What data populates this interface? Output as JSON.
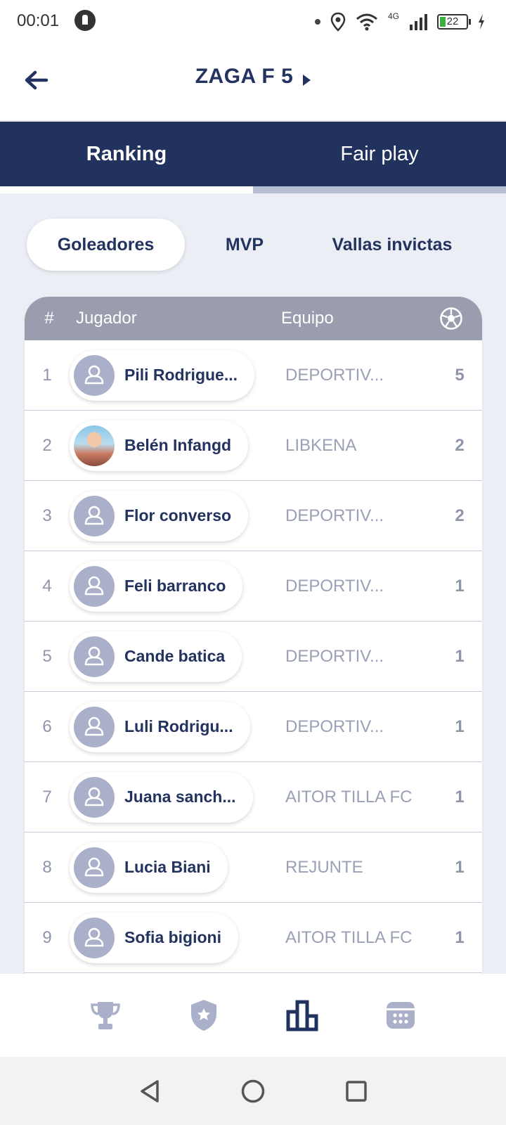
{
  "status_bar": {
    "time": "00:01",
    "network": "4G",
    "battery": "22"
  },
  "header": {
    "title": "ZAGA F 5"
  },
  "top_tabs": [
    {
      "label": "Ranking",
      "active": true
    },
    {
      "label": "Fair play",
      "active": false
    }
  ],
  "sub_tabs": [
    {
      "label": "Goleadores",
      "active": true
    },
    {
      "label": "MVP",
      "active": false
    },
    {
      "label": "Vallas invictas",
      "active": false
    }
  ],
  "table": {
    "columns": {
      "rank": "#",
      "player": "Jugador",
      "team": "Equipo",
      "goals_icon": "soccer-ball-icon"
    },
    "rows": [
      {
        "rank": "1",
        "player": "Pili Rodrigue...",
        "team": "DEPORTIV...",
        "goals": "5",
        "avatar": "placeholder"
      },
      {
        "rank": "2",
        "player": "Belén Infangd",
        "team": "LIBKENA",
        "goals": "2",
        "avatar": "photo"
      },
      {
        "rank": "3",
        "player": "Flor converso",
        "team": "DEPORTIV...",
        "goals": "2",
        "avatar": "placeholder"
      },
      {
        "rank": "4",
        "player": "Feli barranco",
        "team": "DEPORTIV...",
        "goals": "1",
        "avatar": "placeholder"
      },
      {
        "rank": "5",
        "player": "Cande batica",
        "team": "DEPORTIV...",
        "goals": "1",
        "avatar": "placeholder"
      },
      {
        "rank": "6",
        "player": "Luli Rodrigu...",
        "team": "DEPORTIV...",
        "goals": "1",
        "avatar": "placeholder"
      },
      {
        "rank": "7",
        "player": "Juana sanch...",
        "team": "AITOR TILLA FC",
        "goals": "1",
        "avatar": "placeholder"
      },
      {
        "rank": "8",
        "player": "Lucia Biani",
        "team": "REJUNTE",
        "goals": "1",
        "avatar": "placeholder"
      },
      {
        "rank": "9",
        "player": "Sofia bigioni",
        "team": "AITOR TILLA FC",
        "goals": "1",
        "avatar": "placeholder"
      }
    ]
  },
  "bottom_nav": [
    {
      "icon": "trophy-icon",
      "active": false
    },
    {
      "icon": "shield-star-icon",
      "active": false
    },
    {
      "icon": "bar-chart-icon",
      "active": true
    },
    {
      "icon": "calendar-icon",
      "active": false
    }
  ],
  "colors": {
    "primary": "#22325f",
    "inactive_icon": "#aab0c9",
    "header_row": "#9a9dad"
  }
}
